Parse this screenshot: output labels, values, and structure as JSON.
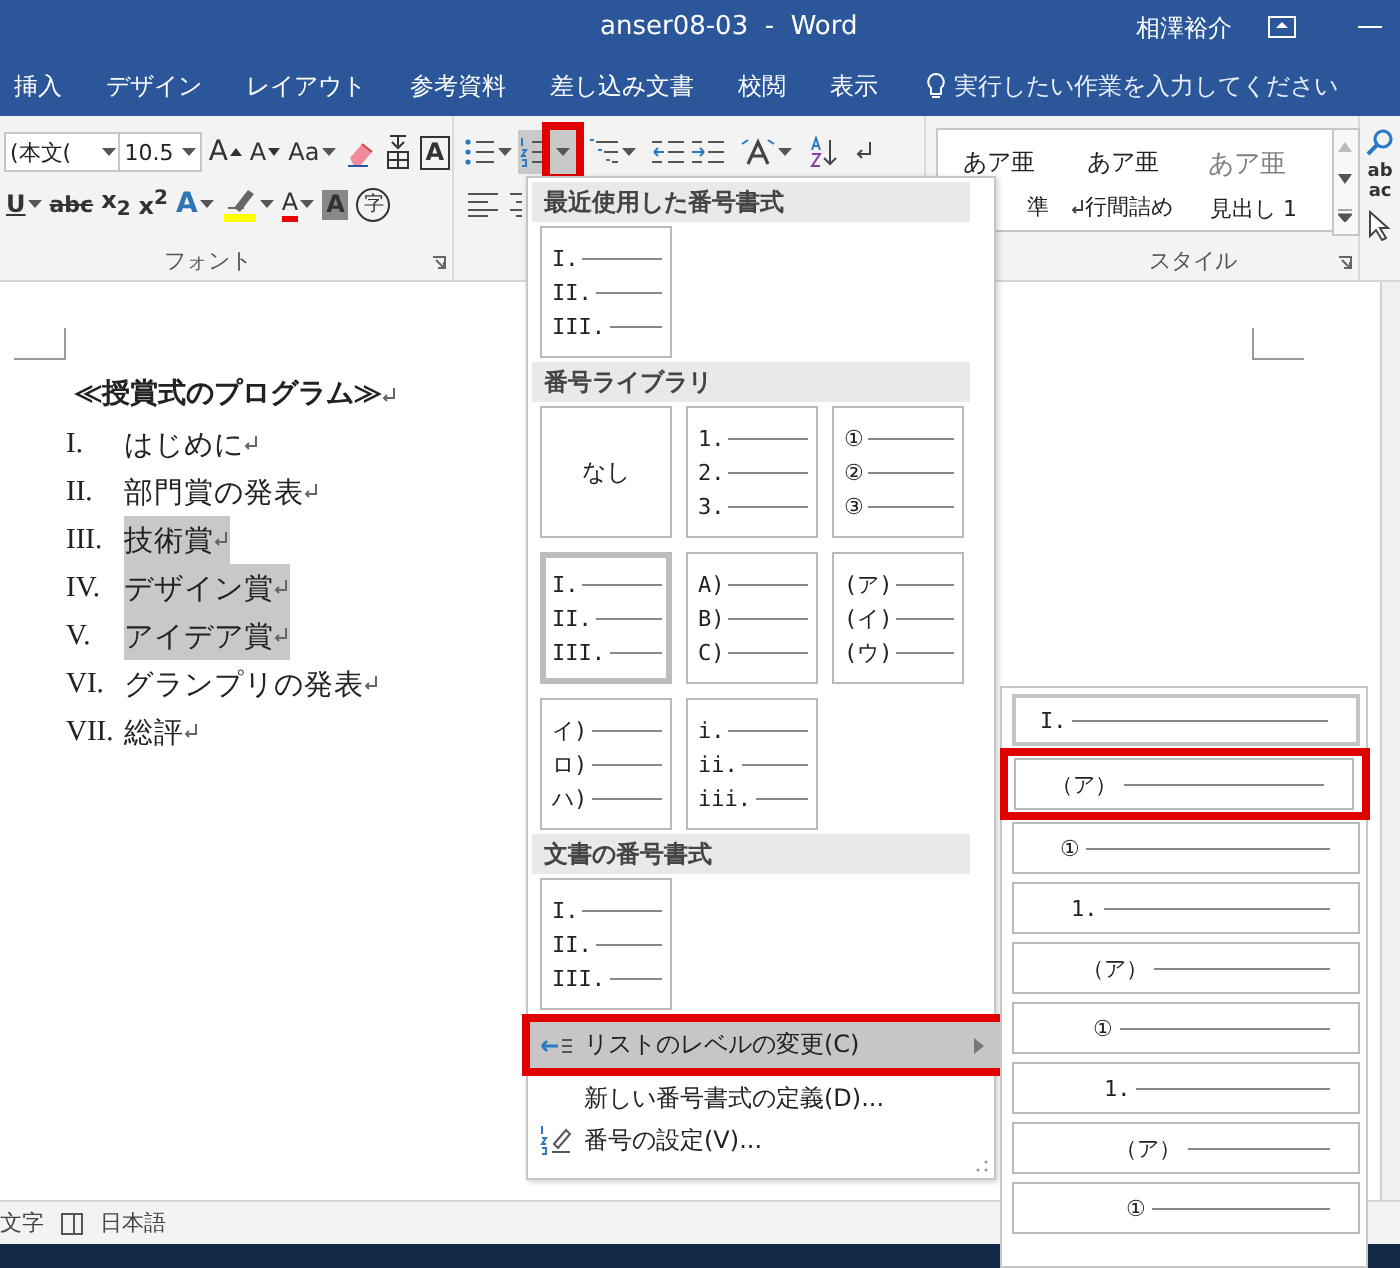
{
  "window": {
    "title": "anser08-03  -  Word",
    "user": "相澤裕介"
  },
  "tabs": [
    {
      "label": "挿入"
    },
    {
      "label": "デザイン"
    },
    {
      "label": "レイアウト"
    },
    {
      "label": "参考資料"
    },
    {
      "label": "差し込み文書"
    },
    {
      "label": "校閲"
    },
    {
      "label": "表示"
    }
  ],
  "tell_me": {
    "placeholder": "実行したい作業を入力してください"
  },
  "font_group": {
    "label": "フォント",
    "font_name": "(本文(",
    "font_size": "10.5",
    "row1": [
      {
        "kind": "grow",
        "text": "A"
      },
      {
        "kind": "shrink",
        "text": "A"
      },
      {
        "kind": "case",
        "text": "Aa"
      },
      {
        "kind": "clear"
      },
      {
        "kind": "ruby"
      },
      {
        "kind": "boxed",
        "text": "A"
      }
    ],
    "row2": [
      {
        "kind": "underline",
        "text": "U"
      },
      {
        "kind": "strike",
        "text": "abc"
      },
      {
        "kind": "sub",
        "text": "x$_{2}$"
      },
      {
        "kind": "sup",
        "text": "x$^{2}$"
      },
      {
        "kind": "effect",
        "text": "A"
      },
      {
        "kind": "highlight"
      },
      {
        "kind": "color",
        "text": "A"
      },
      {
        "kind": "shade",
        "text": "A"
      },
      {
        "kind": "enclose",
        "text": "字"
      }
    ]
  },
  "paragraph_group": {
    "numbering": {
      "highlighted": true
    }
  },
  "style_group": {
    "label": "スタイル",
    "styles": [
      {
        "sample": "あア亜",
        "name": "準",
        "kind": "normal"
      },
      {
        "sample": "あア亜",
        "name": "行間詰め",
        "kind": "normal"
      },
      {
        "sample": "あア亜",
        "name": "見出し 1",
        "kind": "heading"
      }
    ]
  },
  "editing_group": {
    "replace": [
      "ab",
      "ac"
    ]
  },
  "document": {
    "title": "≪授賞式のプログラム≫",
    "items": [
      {
        "number": "I.",
        "text": "はじめに",
        "selected": false
      },
      {
        "number": "II.",
        "text": "部門賞の発表",
        "selected": false
      },
      {
        "number": "III.",
        "text": "技術賞",
        "selected": true
      },
      {
        "number": "IV.",
        "text": "デザイン賞",
        "selected": true
      },
      {
        "number": "V.",
        "text": "アイデア賞",
        "selected": true
      },
      {
        "number": "VI.",
        "text": "グランプリの発表",
        "selected": false
      },
      {
        "number": "VII.",
        "text": "総評",
        "selected": false
      }
    ]
  },
  "numbering_menu": {
    "sections": [
      {
        "title": "最近使用した番号書式",
        "tiles": [
          {
            "kind": "list",
            "lines": [
              "I.",
              "II.",
              "III."
            ],
            "selected": false
          }
        ]
      },
      {
        "title": "番号ライブラリ",
        "tiles": [
          {
            "kind": "none",
            "label": "なし",
            "selected": false
          },
          {
            "kind": "list",
            "lines": [
              "1.",
              "2.",
              "3."
            ],
            "selected": false
          },
          {
            "kind": "list",
            "lines": [
              "①",
              "②",
              "③"
            ],
            "selected": false
          },
          {
            "kind": "list",
            "lines": [
              "I.",
              "II.",
              "III."
            ],
            "selected": true
          },
          {
            "kind": "list",
            "lines": [
              "A)",
              "B)",
              "C)"
            ],
            "selected": false
          },
          {
            "kind": "list",
            "lines": [
              "(ア)",
              "(イ)",
              "(ウ)"
            ],
            "selected": false
          },
          {
            "kind": "list",
            "lines": [
              "イ)",
              "ロ)",
              "ハ)"
            ],
            "selected": false
          },
          {
            "kind": "list",
            "lines": [
              "i.",
              "ii.",
              "iii."
            ],
            "selected": false
          }
        ]
      },
      {
        "title": "文書の番号書式",
        "tiles": [
          {
            "kind": "list",
            "lines": [
              "I.",
              "II.",
              "III."
            ],
            "selected": false
          }
        ]
      }
    ],
    "commands": [
      {
        "label": "リストのレベルの変更(C)",
        "kind": "indent",
        "submenu": true,
        "selected": true,
        "highlighted": true
      },
      {
        "label": "新しい番号書式の定義(D)...",
        "kind": "plain",
        "submenu": false,
        "selected": false,
        "highlighted": false
      },
      {
        "label": "番号の設定(V)...",
        "kind": "numbering",
        "submenu": false,
        "selected": false,
        "highlighted": false
      }
    ]
  },
  "level_menu": {
    "levels": [
      {
        "marker": "I.",
        "selected": true,
        "highlighted": false
      },
      {
        "marker": "（ア）",
        "selected": false,
        "highlighted": true
      },
      {
        "marker": "①",
        "selected": false,
        "highlighted": false
      },
      {
        "marker": "1.",
        "selected": false,
        "highlighted": false
      },
      {
        "marker": "（ア）",
        "selected": false,
        "highlighted": false
      },
      {
        "marker": "①",
        "selected": false,
        "highlighted": false
      },
      {
        "marker": "1.",
        "selected": false,
        "highlighted": false
      },
      {
        "marker": "（ア）",
        "selected": false,
        "highlighted": false
      },
      {
        "marker": "①",
        "selected": false,
        "highlighted": false
      }
    ]
  },
  "status_bar": {
    "words": "文字",
    "language": "日本語"
  }
}
